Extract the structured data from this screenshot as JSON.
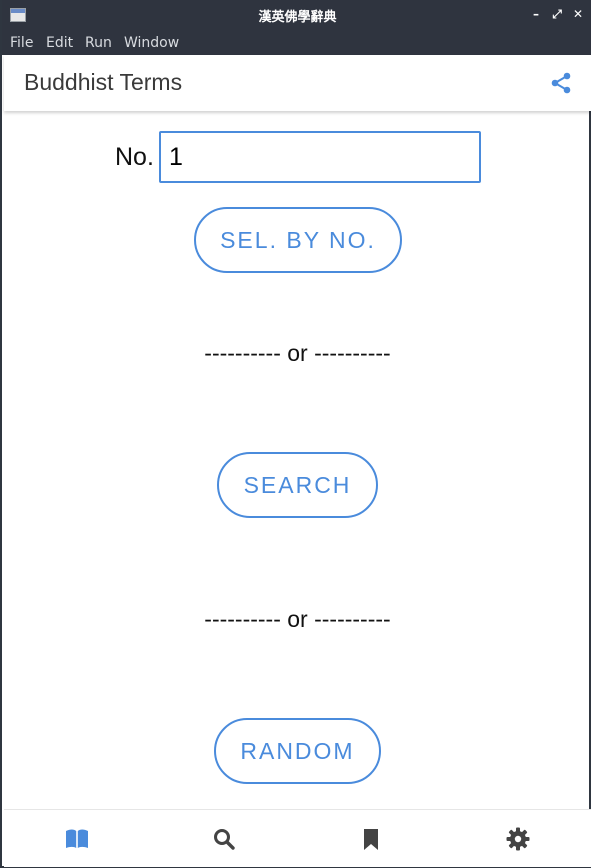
{
  "window": {
    "title": "漢英佛學辭典",
    "controls": {
      "minimize": "–",
      "maximize": "⤢",
      "close": "✕"
    }
  },
  "menu": {
    "items": [
      "File",
      "Edit",
      "Run",
      "Window"
    ]
  },
  "appbar": {
    "title": "Buddhist Terms",
    "share_icon": "share-icon"
  },
  "form": {
    "no_label": "No.",
    "no_value": "1",
    "select_button": "SEL. BY NO.",
    "separator": "---------- or ----------",
    "search_button": "SEARCH",
    "random_button": "RANDOM"
  },
  "bottom_nav": {
    "items": [
      {
        "icon": "book-icon",
        "active": true
      },
      {
        "icon": "search-icon",
        "active": false
      },
      {
        "icon": "bookmark-icon",
        "active": false
      },
      {
        "icon": "gear-icon",
        "active": false
      }
    ]
  },
  "colors": {
    "accent": "#4a8bdc",
    "titlebar": "#2f343f",
    "icon_inactive": "#444444"
  }
}
